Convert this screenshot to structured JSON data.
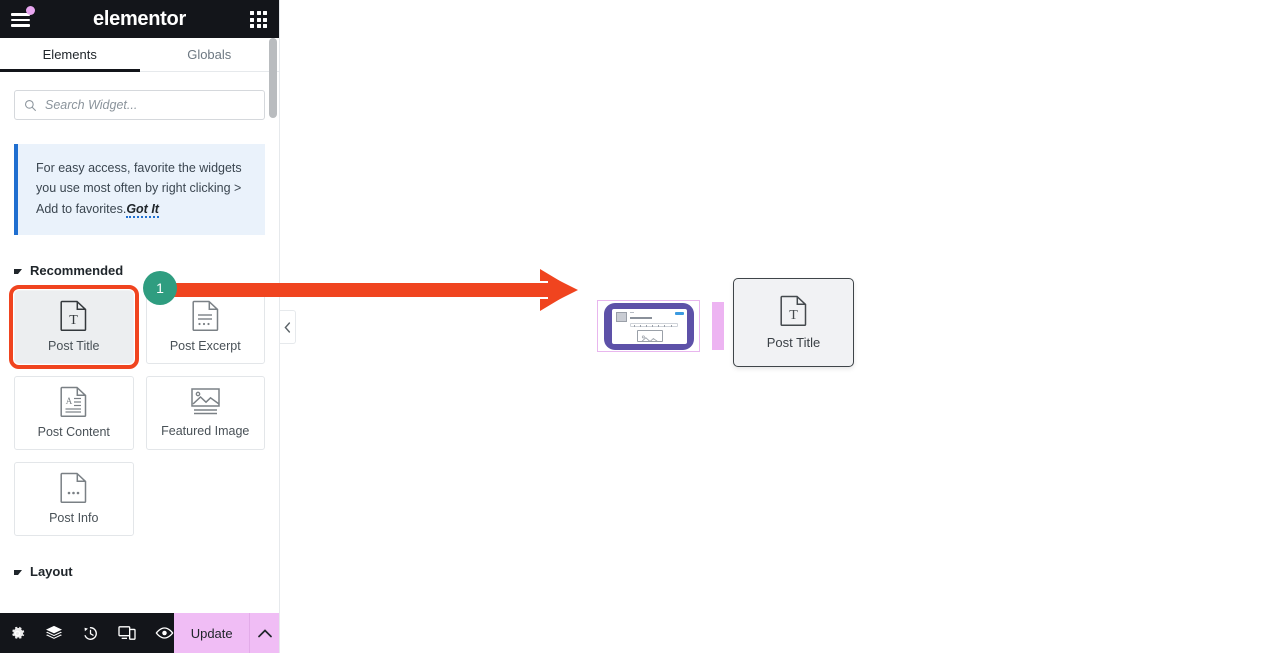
{
  "app": {
    "brand": "elementor",
    "hamburger_icon": "hamburger-menu-icon",
    "notification_dot": "notification-dot",
    "apps_icon": "apps-grid-icon",
    "header_bg": "#13151a"
  },
  "tabs": [
    {
      "label": "Elements",
      "active": true
    },
    {
      "label": "Globals",
      "active": false
    }
  ],
  "search": {
    "placeholder": "Search Widget...",
    "value": "",
    "icon": "search-icon"
  },
  "notice": {
    "text": "For easy access, favorite the widgets you use most often by right clicking > Add to favorites.",
    "action_label": "Got It",
    "accent": "#1f6fd0",
    "background": "#eaf2fb"
  },
  "sections": [
    {
      "title": "Recommended",
      "expanded": true,
      "widgets": [
        {
          "label": "Post Title",
          "icon": "post-title-icon",
          "selected": true
        },
        {
          "label": "Post Excerpt",
          "icon": "post-excerpt-icon",
          "selected": false
        },
        {
          "label": "Post Content",
          "icon": "post-content-icon",
          "selected": false
        },
        {
          "label": "Featured Image",
          "icon": "featured-image-icon",
          "selected": false
        },
        {
          "label": "Post Info",
          "icon": "post-info-icon",
          "selected": false
        }
      ]
    },
    {
      "title": "Layout",
      "expanded": true,
      "widgets": []
    }
  ],
  "footer": {
    "icons": [
      {
        "name": "settings-gear-icon",
        "label": "Settings"
      },
      {
        "name": "layers-navigator-icon",
        "label": "Navigator"
      },
      {
        "name": "history-clock-icon",
        "label": "History"
      },
      {
        "name": "responsive-devices-icon",
        "label": "Responsive Mode"
      },
      {
        "name": "preview-eye-icon",
        "label": "Preview Changes"
      }
    ],
    "update_label": "Update",
    "update_caret_icon": "chevron-up-icon",
    "update_color": "#f0bdf5"
  },
  "panel": {
    "collapse_icon": "chevron-left-icon",
    "scrollbar": "vertical-scrollbar"
  },
  "canvas": {
    "widget_thumbnail": {
      "name": "widget-preview-thumbnail",
      "border_color": "#e8b6ee",
      "device_color": "#5d51a8"
    },
    "drop_indicator": {
      "name": "drop-position-indicator",
      "color": "#edb4f2"
    },
    "drag_ghost": {
      "label": "Post Title",
      "icon": "post-title-icon"
    }
  },
  "annotation": {
    "step_number": "1",
    "badge_color": "#2f9d80",
    "arrow_color": "#f0441f",
    "highlight_color": "#f0441f"
  }
}
